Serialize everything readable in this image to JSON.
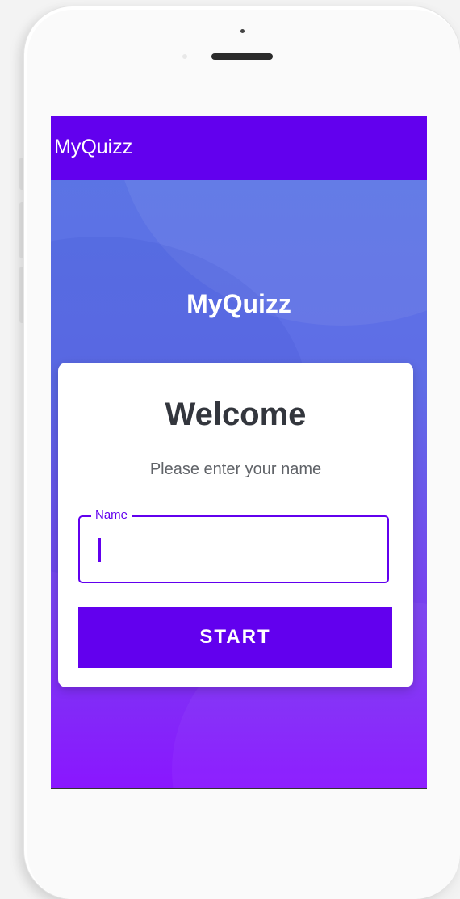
{
  "app": {
    "appbar_title": "MyQuizz",
    "hero_title": "MyQuizz"
  },
  "card": {
    "heading": "Welcome",
    "subtitle": "Please enter your name",
    "name_field": {
      "label": "Name",
      "value": ""
    },
    "start_label": "START"
  },
  "colors": {
    "primary": "#6200ee",
    "heading_text": "#33363d",
    "subtitle_text": "#606368",
    "gradient_top": "#5a76e4",
    "gradient_bottom": "#8a16ff"
  }
}
